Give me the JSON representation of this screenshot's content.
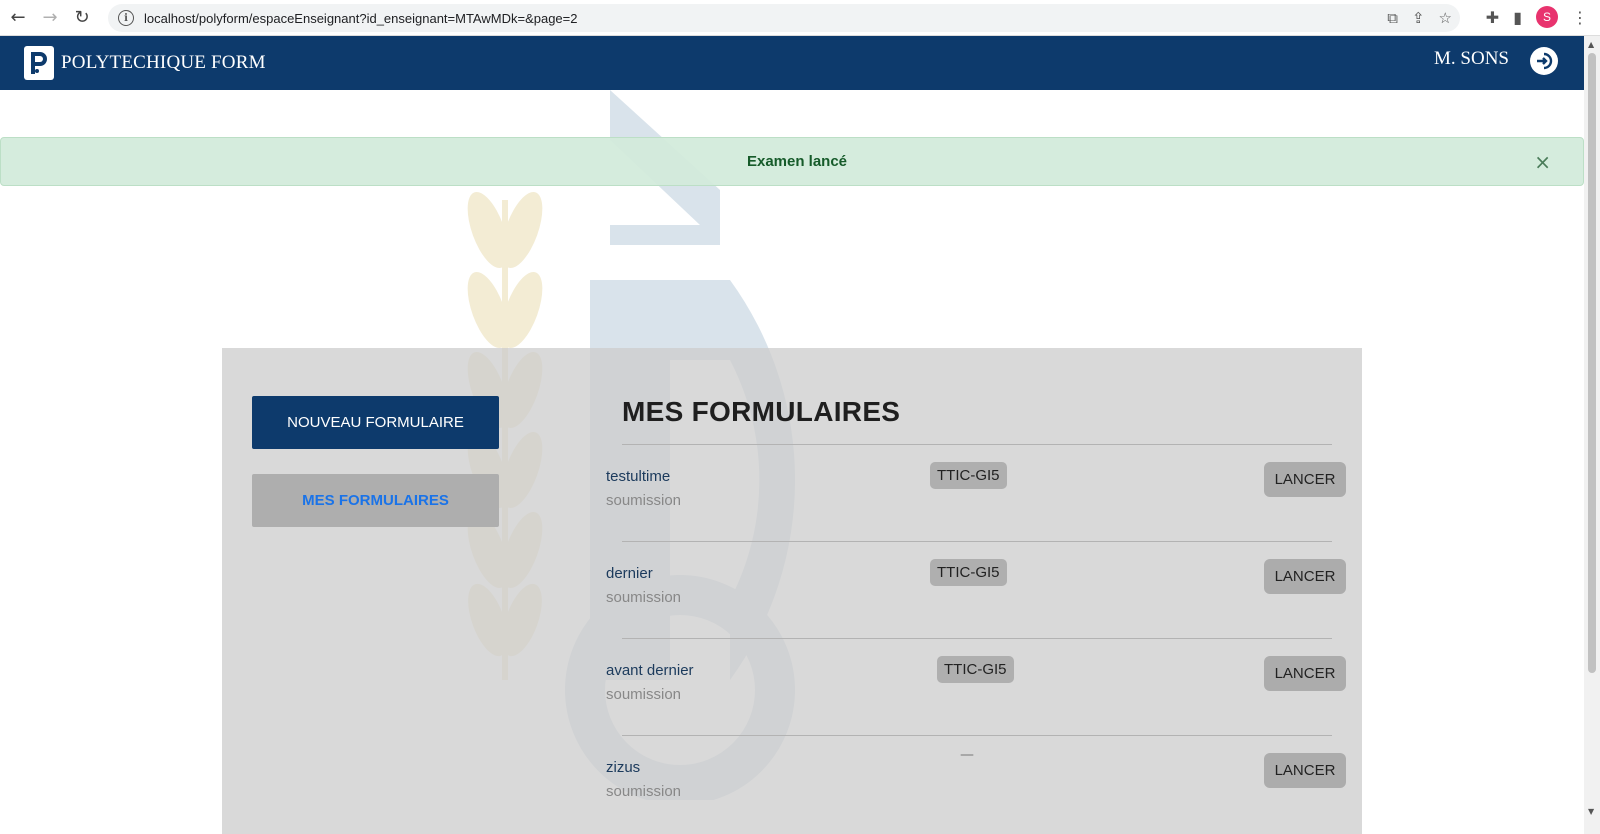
{
  "browser": {
    "url": "localhost/polyform/espaceEnseignant?id_enseignant=MTAwMDk=&page=2",
    "profile_initial": "S"
  },
  "navbar": {
    "brand": "POLYTECHIQUE FORM",
    "user": "M. SONS"
  },
  "alert": {
    "message": "Examen lancé",
    "close": "×"
  },
  "sidebar": {
    "new_form": "NOUVEAU FORMULAIRE",
    "my_forms": "MES FORMULAIRES"
  },
  "main": {
    "title": "MES FORMULAIRES",
    "forms": [
      {
        "name": "testultime",
        "subtitle": "soumission",
        "tag": "TTIC-GI5",
        "action": "LANCER"
      },
      {
        "name": "dernier",
        "subtitle": "soumission",
        "tag": "TTIC-GI5",
        "action": "LANCER"
      },
      {
        "name": "avant dernier",
        "subtitle": "soumission",
        "tag": "TTIC-GI5",
        "action": "LANCER"
      },
      {
        "name": "zizus",
        "subtitle": "soumission",
        "tag": "—",
        "action": "LANCER"
      }
    ]
  },
  "colors": {
    "navbar": "#0d3a6c",
    "alert_bg": "#d4ebda",
    "link": "#1a73e8"
  }
}
